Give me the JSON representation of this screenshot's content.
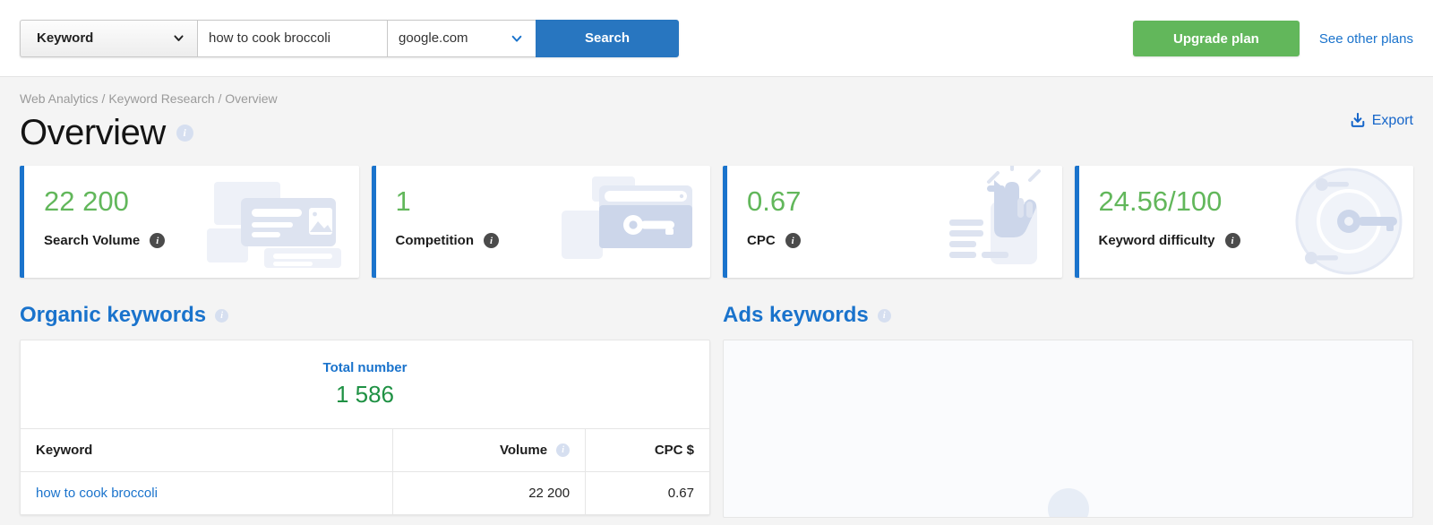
{
  "topbar": {
    "type_select": {
      "value": "Keyword",
      "icon": "chevron-down-icon"
    },
    "keyword_input": {
      "value": "how to cook broccoli",
      "placeholder": "Enter keyword"
    },
    "domain_select": {
      "value": "google.com",
      "icon": "chevron-down-icon"
    },
    "search_button": "Search",
    "upgrade_button": "Upgrade plan",
    "other_plans_link": "See other plans"
  },
  "breadcrumb": "Web Analytics / Keyword Research / Overview",
  "page_title": "Overview",
  "export_label": "Export",
  "cards": [
    {
      "value": "22 200",
      "label": "Search Volume",
      "art": "document-image-illustration"
    },
    {
      "value": "1",
      "label": "Competition",
      "art": "browser-key-illustration"
    },
    {
      "value": "0.67",
      "label": "CPC",
      "art": "click-hand-illustration"
    },
    {
      "value": "24.56/100",
      "label": "Keyword difficulty",
      "art": "key-target-illustration"
    }
  ],
  "organic": {
    "section_title": "Organic keywords",
    "total_label": "Total number",
    "total_value": "1 586",
    "columns": [
      "Keyword",
      "Volume",
      "CPC $"
    ],
    "rows": [
      {
        "keyword": "how to cook broccoli",
        "volume": "22 200",
        "cpc": "0.67"
      }
    ]
  },
  "ads": {
    "section_title": "Ads keywords"
  },
  "colors": {
    "accent_blue": "#1a73cc",
    "value_green": "#62b75b",
    "total_green": "#1f9144",
    "search_blue": "#2876c0",
    "upgrade_green": "#62b75b",
    "page_bg": "#f4f4f4"
  }
}
